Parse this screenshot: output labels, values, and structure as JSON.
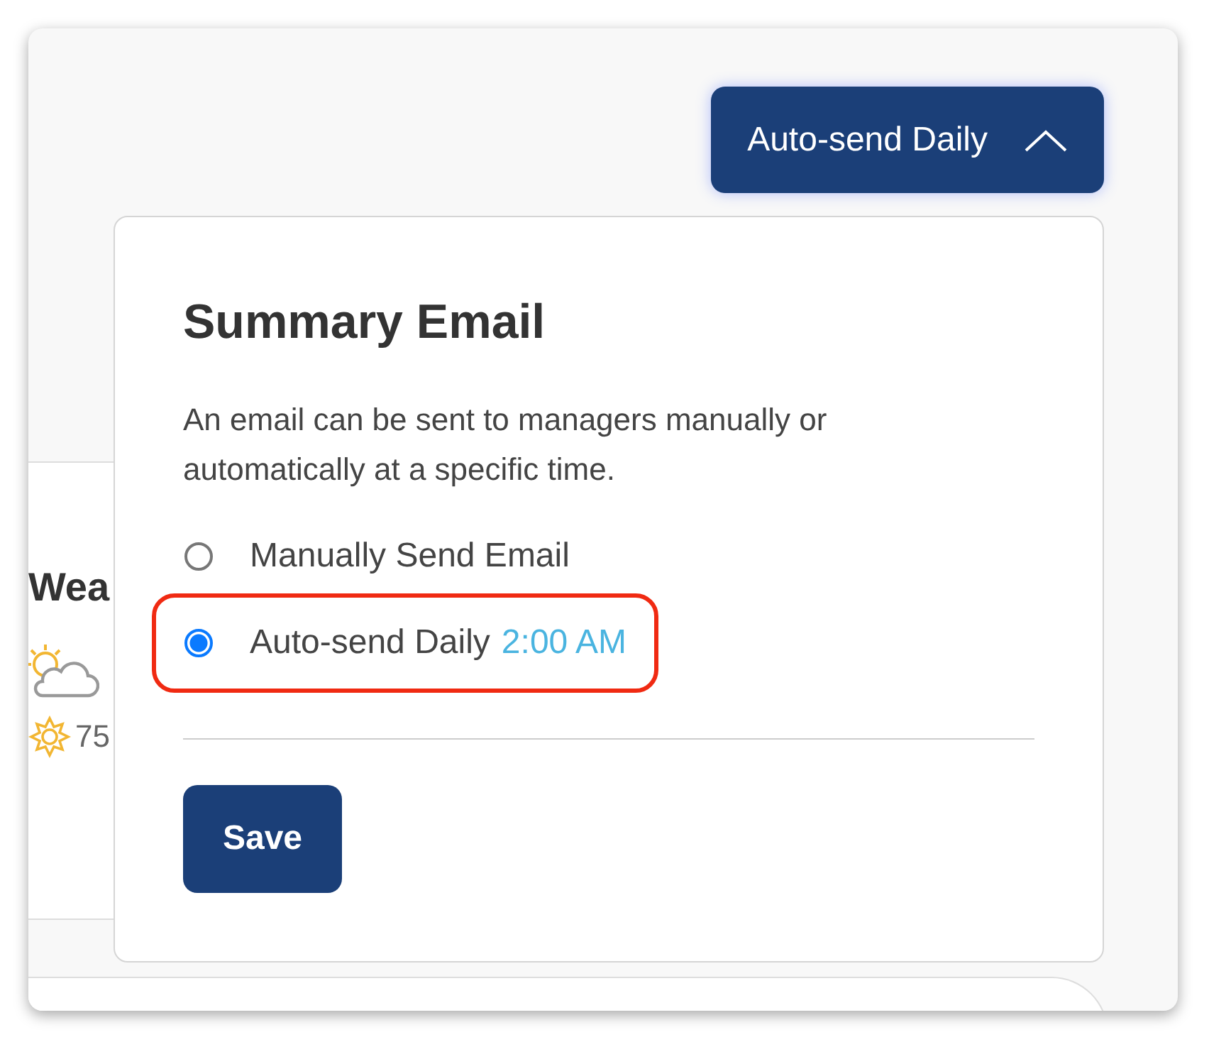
{
  "dropdown_button": {
    "label": "Auto-send Daily",
    "expanded": true
  },
  "weather_card": {
    "title": "Wea",
    "temperature": "75"
  },
  "popover": {
    "title": "Summary Email",
    "description": "An email can be sent to managers manually or automatically at a specific time.",
    "options": [
      {
        "label": "Manually Send Email",
        "selected": false,
        "highlighted": false
      },
      {
        "label": "Auto-send Daily",
        "time": "2:00 AM",
        "selected": true,
        "highlighted": true
      }
    ],
    "save_label": "Save"
  }
}
